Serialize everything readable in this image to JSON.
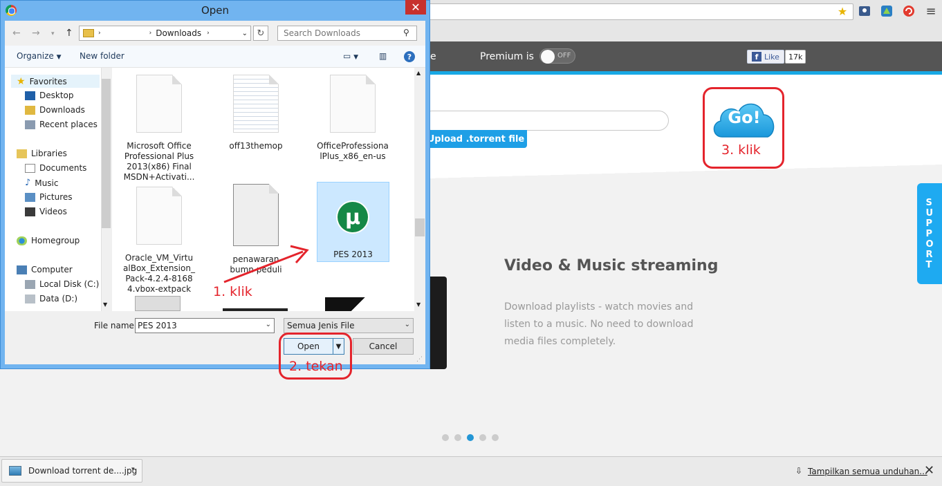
{
  "browser": {
    "toolbar_icons": [
      "star-icon",
      "extension-icon-1",
      "extension-icon-2",
      "extension-icon-3",
      "menu-icon"
    ]
  },
  "site": {
    "nav_partial": "e",
    "premium_label": "Premium is",
    "premium_toggle": "OFF",
    "fb_like": "Like",
    "fb_count": "17k",
    "upload_label": "Upload .torrent file",
    "go_label": "Go!",
    "support_label": "SUPPORT",
    "feature_title": "Video & Music streaming",
    "feature_desc": "Download playlists - watch movies and listen to a music. No need to download media files completely.",
    "carousel_active": 3,
    "carousel_count": 5
  },
  "annotations": {
    "step1": "1. klik",
    "step2": "2. tekan",
    "step3": "3. klik",
    "color": "#e4242c"
  },
  "dialog": {
    "title": "Open",
    "path": "Downloads",
    "search_placeholder": "Search Downloads",
    "organize": "Organize",
    "new_folder": "New folder",
    "nav": {
      "favorites": "Favorites",
      "desktop": "Desktop",
      "downloads": "Downloads",
      "recent": "Recent places",
      "libraries": "Libraries",
      "documents": "Documents",
      "music": "Music",
      "pictures": "Pictures",
      "videos": "Videos",
      "homegroup": "Homegroup",
      "computer": "Computer",
      "local_disk": "Local Disk (C:)",
      "data_disk": "Data (D:)"
    },
    "files": [
      {
        "name": "Microsoft Office Professional Plus 2013(x86) Final MSDN+Activati...",
        "icon": "document-icon"
      },
      {
        "name": "off13themop",
        "icon": "text-document-icon"
      },
      {
        "name": "OfficeProfessionalPlus_x86_en-us",
        "icon": "document-icon"
      },
      {
        "name": "Oracle_VM_VirtualBox_Extension_Pack-4.2.4-81684.vbox-extpack",
        "icon": "document-icon"
      },
      {
        "name": "penawaran bumn peduli",
        "icon": "scanned-document-icon"
      },
      {
        "name": "PES 2013",
        "icon": "utorrent-icon",
        "selected": true
      }
    ],
    "file_name_label": "File name:",
    "file_name_value": "PES 2013",
    "file_type": "Semua Jenis File",
    "open_label": "Open",
    "cancel_label": "Cancel"
  },
  "download_bar": {
    "item": "Download torrent de....jpg",
    "show_all": "Tampilkan semua unduhan..."
  },
  "colors": {
    "accent": "#1e9fe6",
    "dialog_frame": "#71b4f0",
    "selection": "#cce8ff",
    "utorrent_green": "#158846"
  }
}
